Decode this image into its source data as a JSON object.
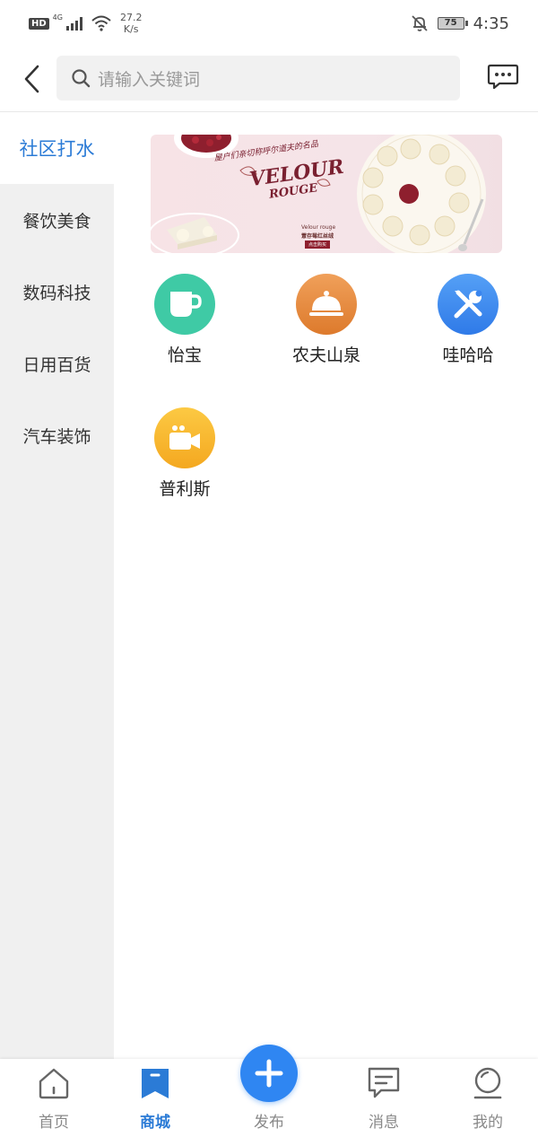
{
  "status_bar": {
    "hd": "HD",
    "network": "4G",
    "speed_value": "27.2",
    "speed_unit": "K/s",
    "battery": "75",
    "time": "4:35"
  },
  "header": {
    "search_placeholder": "请输入关键词"
  },
  "sidebar": {
    "items": [
      {
        "label": "社区打水",
        "active": true
      },
      {
        "label": "餐饮美食",
        "active": false
      },
      {
        "label": "数码科技",
        "active": false
      },
      {
        "label": "日用百货",
        "active": false
      },
      {
        "label": "汽车装饰",
        "active": false
      }
    ]
  },
  "banner": {
    "slogan": "屋户们亲切称呼尔道夫的名品",
    "brand_line1": "VELOUR",
    "brand_line2": "ROUGE",
    "caption_en": "Velour rouge",
    "caption_cn": "薏存莓红丝绒",
    "cta": "点击购买"
  },
  "categories": [
    {
      "label": "怡宝",
      "icon": "cup-icon",
      "color": "#3fcaa5"
    },
    {
      "label": "农夫山泉",
      "icon": "dish-cover-icon",
      "color": "#e8883a"
    },
    {
      "label": "哇哈哈",
      "icon": "tools-icon",
      "color": "#3a85ee"
    },
    {
      "label": "普利斯",
      "icon": "video-camera-icon",
      "color": "#f7b72a"
    }
  ],
  "tabbar": {
    "items": [
      {
        "label": "首页",
        "icon": "home-icon",
        "active": false
      },
      {
        "label": "商城",
        "icon": "shop-bookmark-icon",
        "active": true
      },
      {
        "label": "发布",
        "icon": "plus-icon",
        "active": false
      },
      {
        "label": "消息",
        "icon": "message-icon",
        "active": false
      },
      {
        "label": "我的",
        "icon": "profile-icon",
        "active": false
      }
    ]
  },
  "colors": {
    "accent": "#2b7bd6",
    "publish": "#2f86f2",
    "sidebar_bg": "#f0f0f0"
  }
}
